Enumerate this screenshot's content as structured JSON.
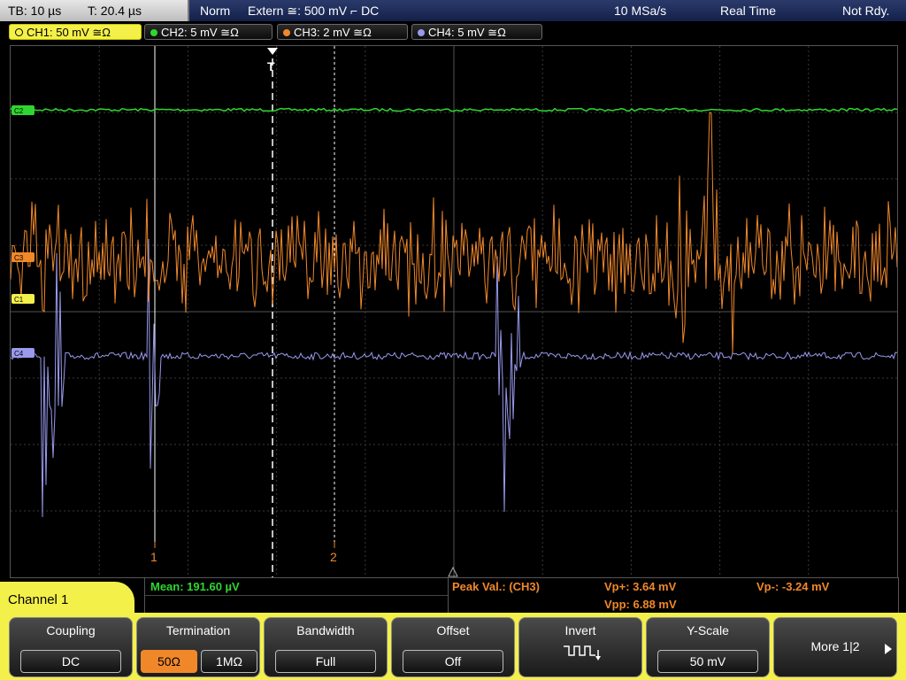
{
  "status_bar": {
    "timebase": "TB: 10 µs",
    "trigger_time": "T: 20.4 µs",
    "mode": "Norm",
    "trigger": "Extern ≅: 500 mV ⌐ DC",
    "sample_rate": "10 MSa/s",
    "acq_mode": "Real Time",
    "ready": "Not Rdy."
  },
  "channel_tabs": [
    {
      "label": "CH1: 50 mV ≅Ω",
      "color": "#f3f049"
    },
    {
      "label": "CH2: 5 mV ≅Ω",
      "color": "#2fd62f"
    },
    {
      "label": "CH3: 2 mV ≅Ω",
      "color": "#f0882a"
    },
    {
      "label": "CH4: 5 mV ≅Ω",
      "color": "#9999ee"
    }
  ],
  "plot": {
    "trigger_marker": "T",
    "cursor1_label": "1",
    "cursor2_label": "2",
    "ch_markers": [
      "C2",
      "C3",
      "C1",
      "C4"
    ],
    "colors": {
      "ch1": "#f3f049",
      "ch2": "#2fd62f",
      "ch3": "#f0882a",
      "ch4": "#9999ee",
      "grid": "#3a3a3a"
    }
  },
  "measurements": {
    "mean": "Mean: 191.60 µV",
    "peak_label": "Peak Val.:  (CH3)",
    "vp_plus": "Vp+: 3.64 mV",
    "vp_minus": "Vp-: -3.24 mV",
    "vpp": "Vpp: 6.88 mV"
  },
  "channel_panel": "Channel 1",
  "softkeys": [
    {
      "title": "Coupling",
      "value": "DC"
    },
    {
      "title": "Termination",
      "value_a": "50Ω",
      "value_b": "1MΩ"
    },
    {
      "title": "Bandwidth",
      "value": "Full"
    },
    {
      "title": "Offset",
      "value": "Off"
    },
    {
      "title": "Invert",
      "value": "invert-icon"
    },
    {
      "title": "Y-Scale",
      "value": "50 mV"
    },
    {
      "title": "More 1|2",
      "value": "arrow-right-icon"
    }
  ]
}
